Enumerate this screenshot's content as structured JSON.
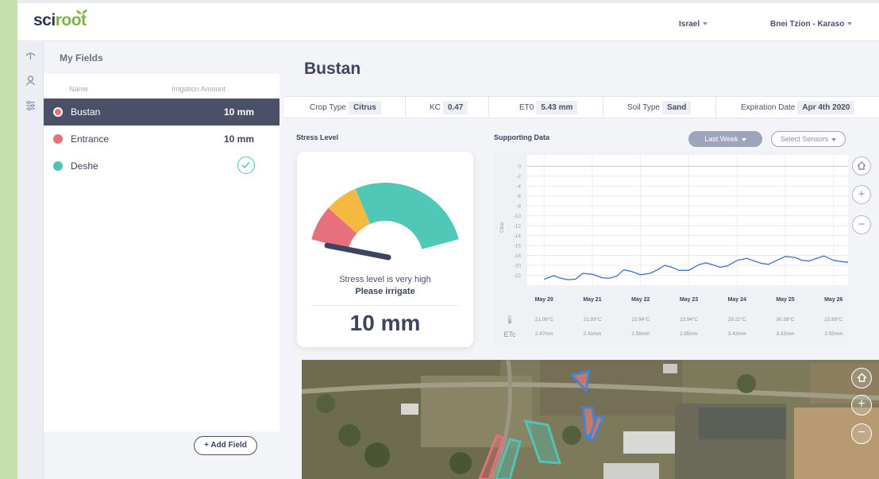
{
  "brand": {
    "logo_text_a": "sci",
    "logo_text_b": "root"
  },
  "topbar": {
    "country": "Israel",
    "location": "Bnei Tzion - Karaso"
  },
  "sidebar": {
    "title": "My Fields",
    "col_name": "Name",
    "col_amount": "Irrigation Amount",
    "fields": [
      {
        "name": "Bustan",
        "amount": "10 mm",
        "status_color": "#e8707c",
        "selected": true
      },
      {
        "name": "Entrance",
        "amount": "10 mm",
        "status_color": "#e8707c",
        "selected": false
      },
      {
        "name": "Deshe",
        "amount": "",
        "status_color": "#4fc3b4",
        "selected": false
      }
    ],
    "add_label": "+ Add Field"
  },
  "main": {
    "title": "Bustan",
    "info": {
      "crop_label": "Crop Type",
      "crop_value": "Citrus",
      "kc_label": "KC",
      "kc_value": "0.47",
      "et0_label": "ET0",
      "et0_value": "5.43 mm",
      "soil_label": "Soil Type",
      "soil_value": "Sand",
      "exp_label": "Expiration Date",
      "exp_value": "Apr 4th 2020"
    },
    "stress": {
      "label": "Stress Level",
      "message": "Stress level is very high",
      "sub": "Please irrigate",
      "value": "10 mm",
      "colors": {
        "red": "#e8707c",
        "yellow": "#f5b841",
        "teal": "#4fc8b8"
      }
    },
    "support": {
      "label": "Supporting Data",
      "period": "Last Week",
      "sensors": "Select Sensors"
    }
  },
  "chart_data": {
    "type": "line",
    "ylabel": "Cbar",
    "ylim": [
      -24,
      1
    ],
    "yticks": [
      "0",
      "-2",
      "-4",
      "-6",
      "-8",
      "-10",
      "-12",
      "-14",
      "-16",
      "-18",
      "-20",
      "-22"
    ],
    "x_labels": [
      "May 20",
      "May 21",
      "May 22",
      "May 23",
      "May 24",
      "May 25",
      "May 26"
    ],
    "temps": [
      "21.09°C",
      "21.93°C",
      "22.94°C",
      "23.94°C",
      "29.22°C",
      "30.39°C",
      "22.80°C"
    ],
    "etc": [
      "2.47mm",
      "2.41mm",
      "2.56mm",
      "2.85mm",
      "3.42mm",
      "3.32mm",
      "2.55mm"
    ],
    "temp_symbol": "🌡",
    "etc_label": "ETc",
    "series": [
      {
        "color": "#3f6fc8",
        "x": [
          0,
          0.2,
          0.35,
          0.5,
          0.65,
          0.8,
          1.0,
          1.2,
          1.35,
          1.5,
          1.65,
          1.8,
          2.0,
          2.2,
          2.35,
          2.5,
          2.65,
          2.8,
          3.0,
          3.2,
          3.35,
          3.5,
          3.65,
          3.8,
          4.0,
          4.2,
          4.35,
          4.5,
          4.65,
          4.8,
          5.0,
          5.2,
          5.35,
          5.5,
          5.65,
          5.8,
          6.0,
          6.3
        ],
        "y": [
          -22.8,
          -22.1,
          -22.6,
          -22.9,
          -22.8,
          -21.6,
          -21.8,
          -22.5,
          -22.6,
          -22.2,
          -20.9,
          -21.2,
          -21.9,
          -21.6,
          -20.9,
          -20.0,
          -20.4,
          -21.0,
          -21.0,
          -19.9,
          -19.5,
          -19.9,
          -20.4,
          -20.1,
          -19.0,
          -18.6,
          -19.1,
          -19.6,
          -19.8,
          -19.1,
          -18.2,
          -18.4,
          -19.0,
          -19.1,
          -18.6,
          -18.1,
          -19.0,
          -19.4
        ]
      }
    ]
  }
}
